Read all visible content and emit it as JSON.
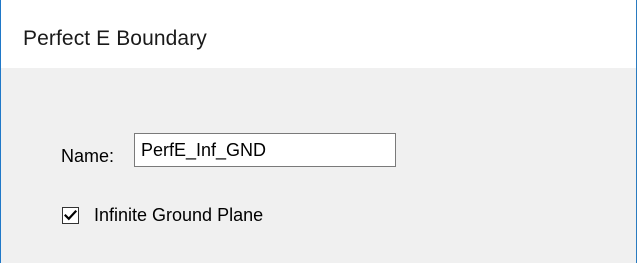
{
  "dialog": {
    "title": "Perfect E Boundary",
    "name_label": "Name:",
    "name_value": "PerfE_Inf_GND",
    "infinite_ground_plane": {
      "label": "Infinite Ground Plane",
      "checked": true
    }
  }
}
